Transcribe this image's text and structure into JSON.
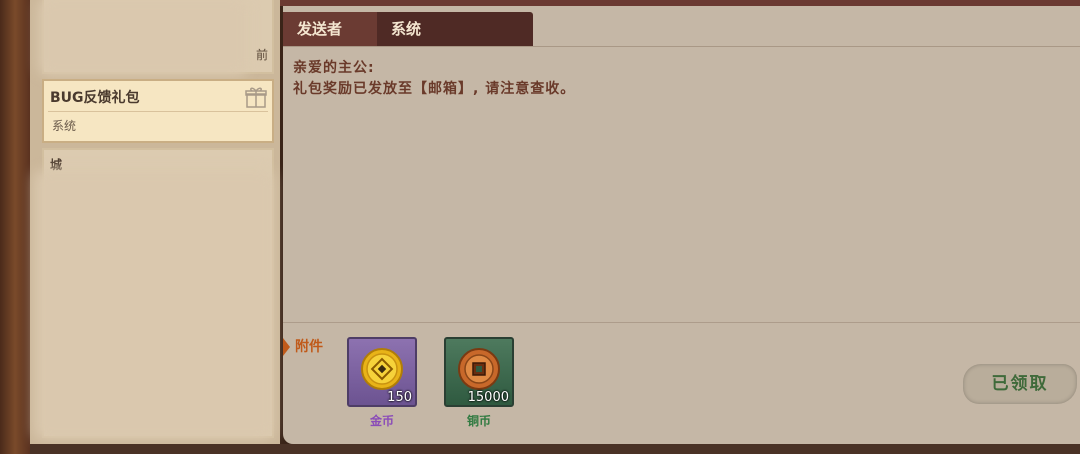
{
  "mail_list": {
    "items": [
      {
        "title": "",
        "sender": "",
        "state": "blurred",
        "partial_char": "前"
      },
      {
        "title": "BUG反馈礼包",
        "sender": "系统",
        "state": "selected"
      },
      {
        "title": "城",
        "sender": "",
        "state": "blurred"
      }
    ]
  },
  "detail": {
    "tabs": [
      {
        "label": "发送者"
      },
      {
        "label": "系统"
      }
    ],
    "message_lines": [
      "亲爱的主公:",
      "礼包奖励已发放至【邮箱】, 请注意查收。"
    ],
    "attachments_label": "附件",
    "attachments": [
      {
        "name": "金币",
        "count": "150",
        "icon": "gold-coin-icon",
        "color": "#8a4bb8"
      },
      {
        "name": "铜币",
        "count": "15000",
        "icon": "copper-coin-icon",
        "color": "#2f7a40"
      }
    ],
    "claim_button": "已领取"
  }
}
